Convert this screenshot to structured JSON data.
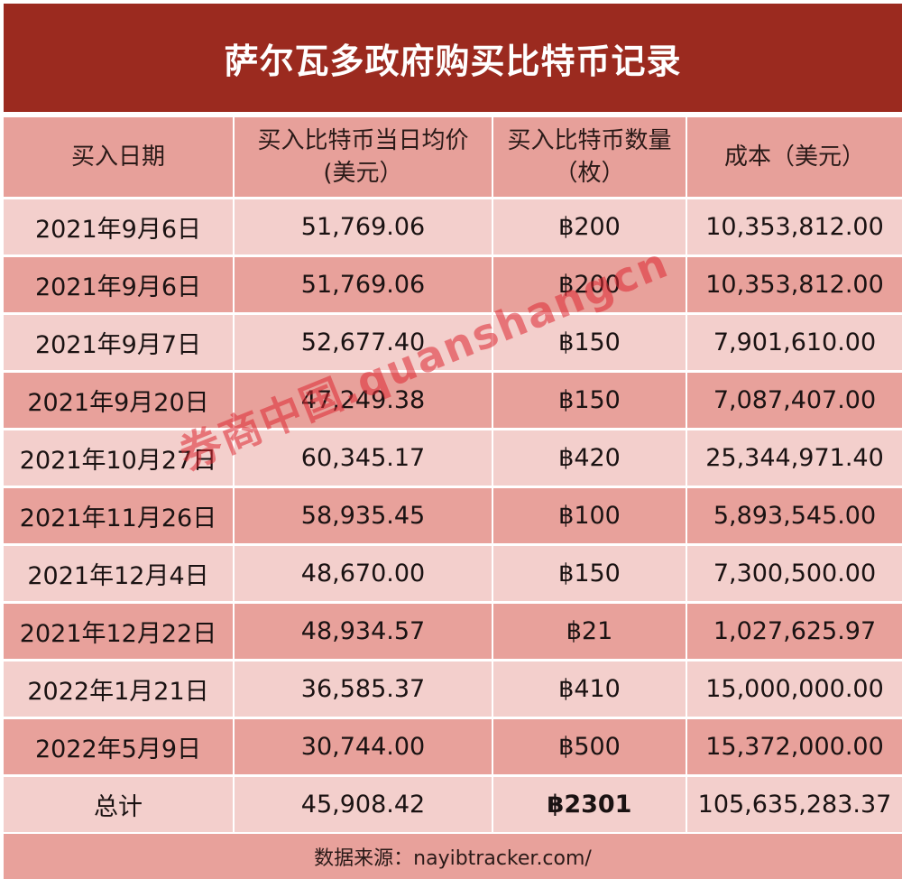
{
  "title": "萨尔瓦多政府购买比特币记录",
  "headers": [
    "买入日期",
    "买入比特币当日均价\n(美元）",
    "买入比特币数量\n（枚）",
    "成本（美元）"
  ],
  "header_lines": [
    [
      "买入日期"
    ],
    [
      "买入比特币当日均价",
      "(美元）"
    ],
    [
      "买入比特币数量",
      "（枚）"
    ],
    [
      "成本（美元）"
    ]
  ],
  "rows": [
    {
      "date": "2021年9月6日",
      "price": "51,769.06",
      "qty": "฿200",
      "cost": "10,353,812.00"
    },
    {
      "date": "2021年9月6日",
      "price": "51,769.06",
      "qty": "฿200",
      "cost": "10,353,812.00"
    },
    {
      "date": "2021年9月7日",
      "price": "52,677.40",
      "qty": "฿150",
      "cost": "7,901,610.00"
    },
    {
      "date": "2021年9月20日",
      "price": "47,249.38",
      "qty": "฿150",
      "cost": "7,087,407.00"
    },
    {
      "date": "2021年10月27日",
      "price": "60,345.17",
      "qty": "฿420",
      "cost": "25,344,971.40"
    },
    {
      "date": "2021年11月26日",
      "price": "58,935.45",
      "qty": "฿100",
      "cost": "5,893,545.00"
    },
    {
      "date": "2021年12月4日",
      "price": "48,670.00",
      "qty": "฿150",
      "cost": "7,300,500.00"
    },
    {
      "date": "2021年12月22日",
      "price": "48,934.57",
      "qty": "฿21",
      "cost": "1,027,625.97"
    },
    {
      "date": "2022年1月21日",
      "price": "36,585.37",
      "qty": "฿410",
      "cost": "15,000,000.00"
    },
    {
      "date": "2022年5月9日",
      "price": "30,744.00",
      "qty": "฿500",
      "cost": "15,372,000.00"
    }
  ],
  "total": {
    "label": "总计",
    "price": "45,908.42",
    "qty": "฿2301",
    "cost": "105,635,283.37"
  },
  "footer": "数据来源：nayibtracker.com/",
  "watermark": "券商中国.quanshangcn",
  "colors": {
    "banner": "#9b2a1f",
    "row_light": "#f3cfcc",
    "row_dark": "#e8a19b",
    "watermark": "#dc2832"
  }
}
